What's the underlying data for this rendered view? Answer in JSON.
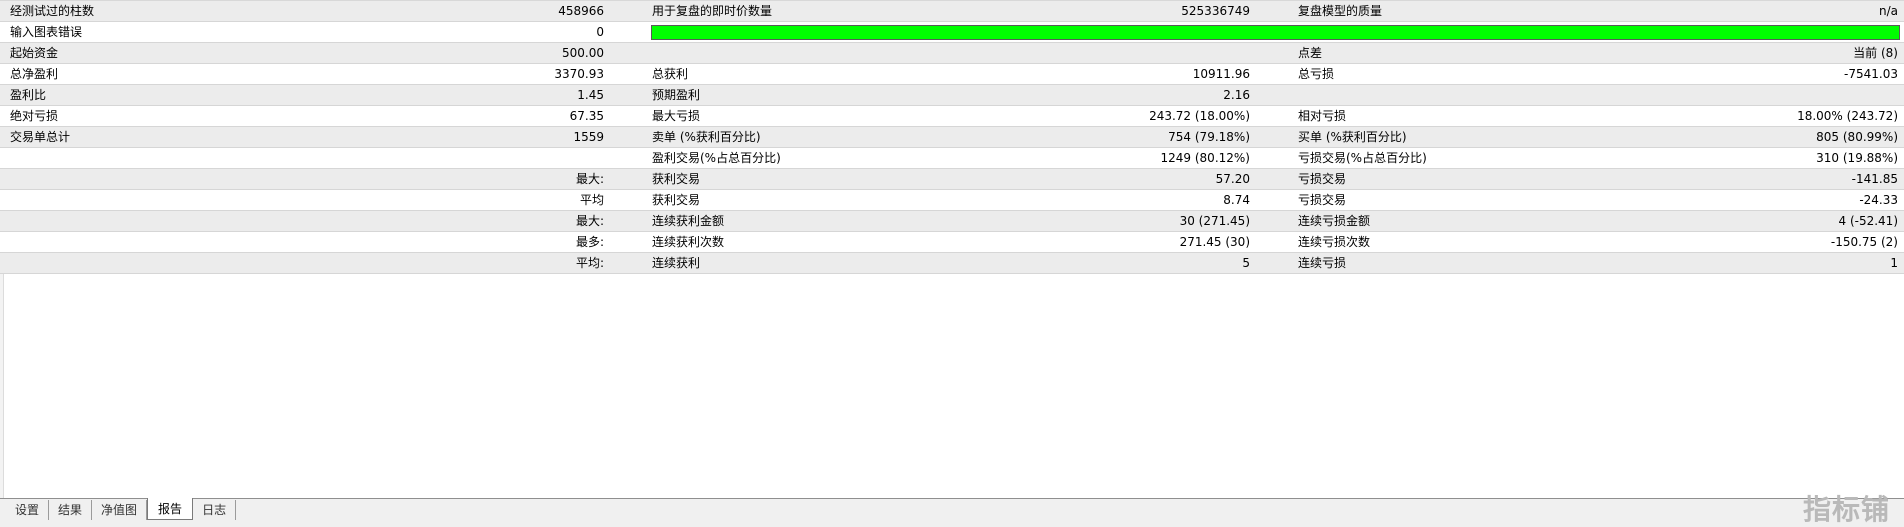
{
  "report": {
    "rows": [
      {
        "shade": true,
        "l1": "经测试过的柱数",
        "v1": "458966",
        "l2": "用于复盘的即时价数量",
        "v2": "525336749",
        "l3": "复盘模型的质量",
        "v3": "n/a"
      },
      {
        "shade": false,
        "l1": "输入图表错误",
        "v1": "0",
        "bar": true
      },
      {
        "shade": true,
        "l1": "起始资金",
        "v1": "500.00",
        "l2": "",
        "v2": "",
        "l3": "点差",
        "v3": "当前 (8)"
      },
      {
        "shade": false,
        "l1": "总净盈利",
        "v1": "3370.93",
        "l2": "总获利",
        "v2": "10911.96",
        "l3": "总亏损",
        "v3": "-7541.03"
      },
      {
        "shade": true,
        "l1": "盈利比",
        "v1": "1.45",
        "l2": "预期盈利",
        "v2": "2.16",
        "l3": "",
        "v3": ""
      },
      {
        "shade": false,
        "l1": "绝对亏损",
        "v1": "67.35",
        "l2": "最大亏损",
        "v2": "243.72 (18.00%)",
        "l3": "相对亏损",
        "v3": "18.00% (243.72)"
      },
      {
        "shade": true,
        "l1": "交易单总计",
        "v1": "1559",
        "l2": "卖单 (%获利百分比)",
        "v2": "754 (79.18%)",
        "l3": "买单 (%获利百分比)",
        "v3": "805 (80.99%)"
      },
      {
        "shade": false,
        "l1": "",
        "v1": "",
        "l2": "盈利交易(%占总百分比)",
        "v2": "1249 (80.12%)",
        "l3": "亏损交易(%占总百分比)",
        "v3": "310 (19.88%)"
      },
      {
        "shade": true,
        "l1": "",
        "v1": "最大:",
        "l2": "获利交易",
        "v2": "57.20",
        "l3": "亏损交易",
        "v3": "-141.85"
      },
      {
        "shade": false,
        "l1": "",
        "v1": "平均",
        "l2": "获利交易",
        "v2": "8.74",
        "l3": "亏损交易",
        "v3": "-24.33"
      },
      {
        "shade": true,
        "l1": "",
        "v1": "最大:",
        "l2": "连续获利金额",
        "v2": "30 (271.45)",
        "l3": "连续亏损金额",
        "v3": "4 (-52.41)"
      },
      {
        "shade": false,
        "l1": "",
        "v1": "最多:",
        "l2": "连续获利次数",
        "v2": "271.45 (30)",
        "l3": "连续亏损次数",
        "v3": "-150.75 (2)"
      },
      {
        "shade": true,
        "l1": "",
        "v1": "平均:",
        "l2": "连续获利",
        "v2": "5",
        "l3": "连续亏损",
        "v3": "1"
      }
    ]
  },
  "quality_bar": {
    "fill_fraction": 1.0,
    "color": "#00ff00"
  },
  "tabs": [
    {
      "label": "设置",
      "active": false
    },
    {
      "label": "结果",
      "active": false
    },
    {
      "label": "净值图",
      "active": false
    },
    {
      "label": "报告",
      "active": true
    },
    {
      "label": "日志",
      "active": false
    }
  ],
  "watermark": "指标铺"
}
